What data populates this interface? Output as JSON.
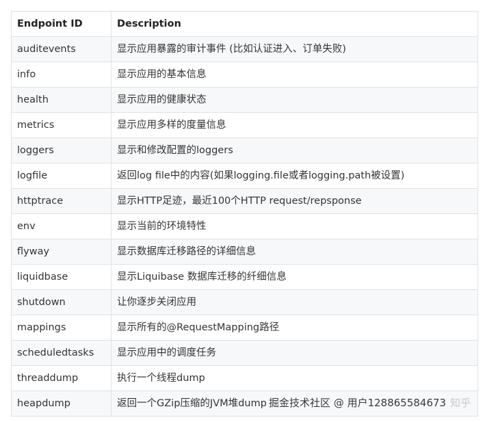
{
  "table": {
    "headers": [
      "Endpoint ID",
      "Description"
    ],
    "rows": [
      {
        "id": "auditevents",
        "desc": "显示应用暴露的审计事件 (比如认证进入、订单失败)"
      },
      {
        "id": "info",
        "desc": "显示应用的基本信息"
      },
      {
        "id": "health",
        "desc": "显示应用的健康状态"
      },
      {
        "id": "metrics",
        "desc": "显示应用多样的度量信息"
      },
      {
        "id": "loggers",
        "desc": "显示和修改配置的loggers"
      },
      {
        "id": "logfile",
        "desc": "返回log file中的内容(如果logging.file或者logging.path被设置)"
      },
      {
        "id": "httptrace",
        "desc": "显示HTTP足迹，最近100个HTTP request/repsponse"
      },
      {
        "id": "env",
        "desc": "显示当前的环境特性"
      },
      {
        "id": "flyway",
        "desc": "显示数据库迁移路径的详细信息"
      },
      {
        "id": "liquidbase",
        "desc": "显示Liquibase 数据库迁移的纤细信息"
      },
      {
        "id": "shutdown",
        "desc": "让你逐步关闭应用"
      },
      {
        "id": "mappings",
        "desc": "显示所有的@RequestMapping路径"
      },
      {
        "id": "scheduledtasks",
        "desc": "显示应用中的调度任务"
      },
      {
        "id": "threaddump",
        "desc": "执行一个线程dump"
      },
      {
        "id": "heapdump",
        "desc": "返回一个GZip压缩的JVM堆dump"
      }
    ]
  },
  "watermark": {
    "text": "掘金技术社区 @ 用户128865584673",
    "ghost_text": "知乎"
  }
}
